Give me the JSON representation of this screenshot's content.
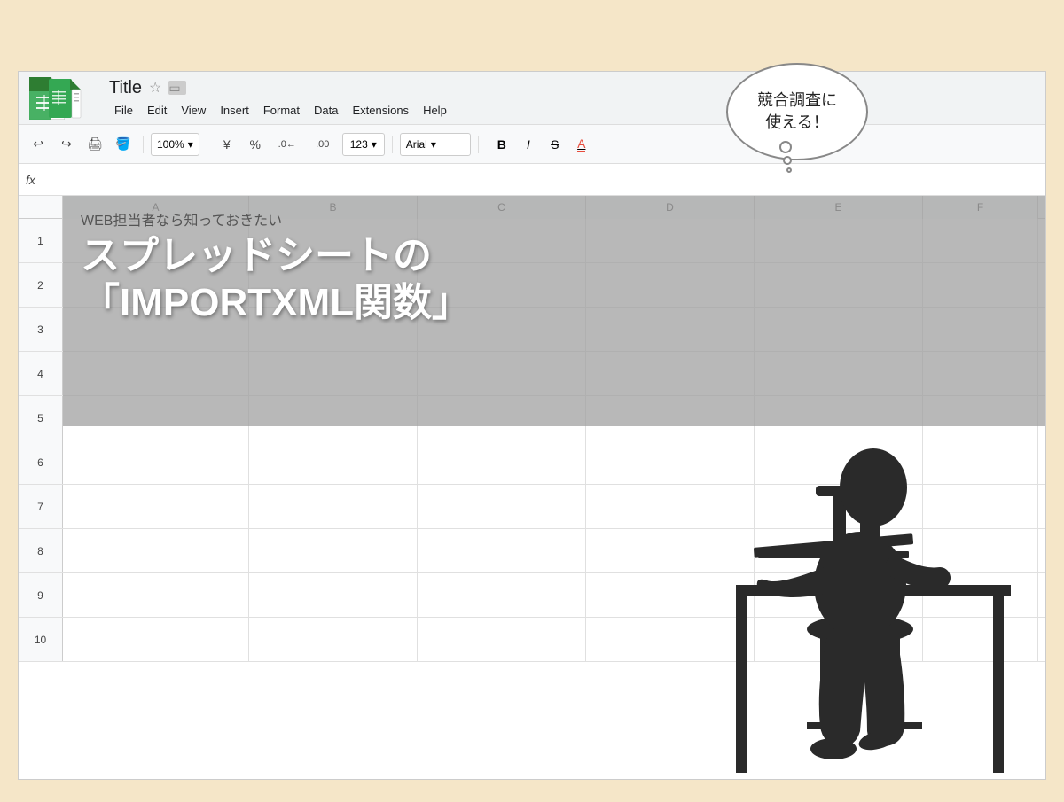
{
  "page": {
    "background_color": "#f5e6c8"
  },
  "titlebar": {
    "app_name": "Google Sheets",
    "document_title": "Title",
    "star_icon": "☆",
    "folder_icon": "□"
  },
  "menubar": {
    "items": [
      "File",
      "Edit",
      "View",
      "Insert",
      "Format",
      "Data",
      "Extensions",
      "Help"
    ]
  },
  "toolbar": {
    "zoom_level": "100%",
    "currency_symbol": "¥",
    "percent_symbol": "%",
    "decimal_less": ".0",
    "decimal_more": ".00",
    "format_123": "123",
    "font_name": "Arial",
    "bold": "B",
    "italic": "I",
    "strikethrough": "S",
    "underline_A": "A"
  },
  "formula_bar": {
    "fx_label": "fx"
  },
  "columns": [
    "A",
    "B",
    "C",
    "D",
    "E",
    "F"
  ],
  "rows": [
    1,
    2,
    3,
    4,
    5,
    6,
    7,
    8,
    9,
    10
  ],
  "thought_bubble": {
    "line1": "競合調査に",
    "line2": "使える！"
  },
  "overlay_text": {
    "subtitle": "WEB担当者なら知っておきたい",
    "main_title_line1": "スプレッドシートの",
    "main_title_line2": "「IMPORTXML関数」"
  }
}
